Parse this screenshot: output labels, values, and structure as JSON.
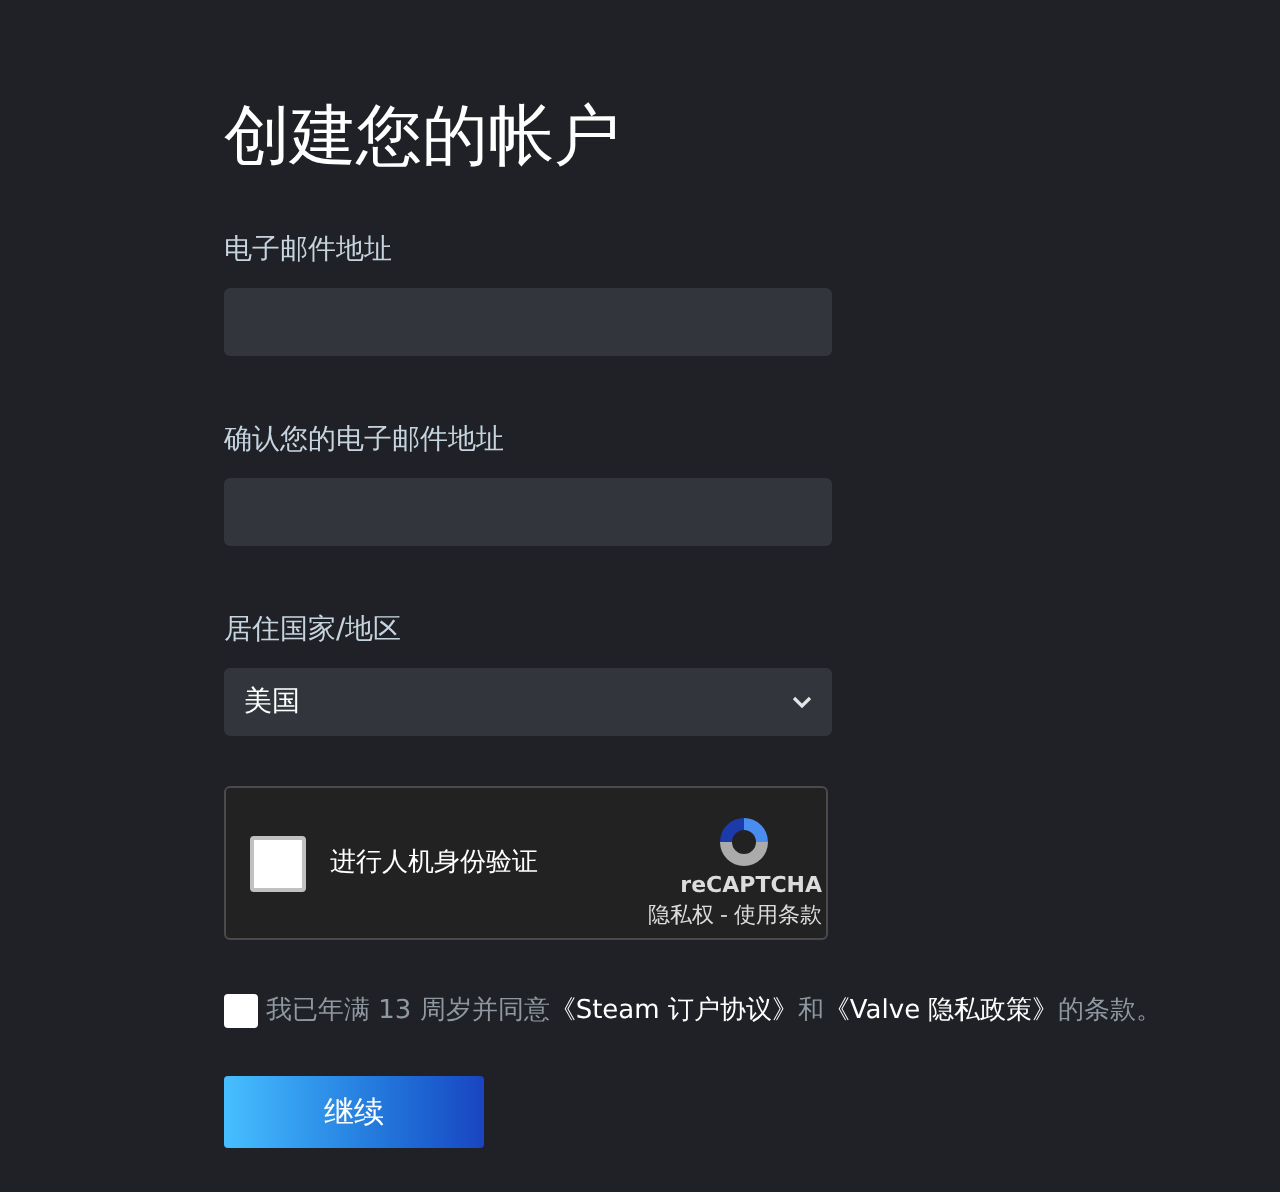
{
  "title": "创建您的帐户",
  "fields": [
    {
      "label": "电子邮件地址",
      "kind": "text"
    },
    {
      "label": "确认您的电子邮件地址",
      "kind": "text"
    },
    {
      "label": "居住国家/地区",
      "kind": "select",
      "value": "美国"
    }
  ],
  "captcha": {
    "label": "进行人机身份验证",
    "checked": false,
    "brand": "reCAPTCHA",
    "privacy": "隐私权",
    "separator": "-",
    "terms": "使用条款"
  },
  "agreement": {
    "checked": false,
    "parts": [
      {
        "kind": "text",
        "text": "我已年满 13 周岁并同意"
      },
      {
        "kind": "link",
        "text": "《Steam 订户协议》"
      },
      {
        "kind": "text",
        "text": "和"
      },
      {
        "kind": "link",
        "text": "《Valve 隐私政策》"
      },
      {
        "kind": "text",
        "text": "的条款。"
      }
    ]
  },
  "submit": "继续"
}
